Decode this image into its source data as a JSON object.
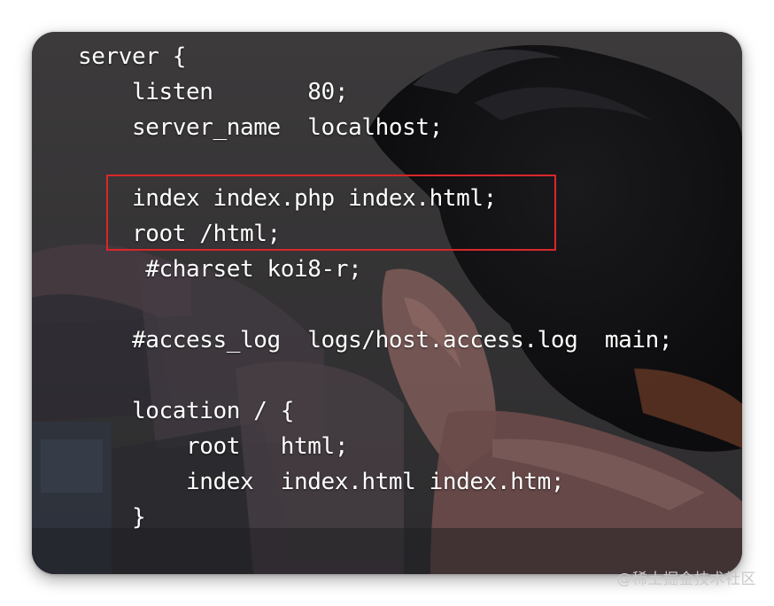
{
  "code_lines": [
    "server {",
    "    listen       80;",
    "    server_name  localhost;",
    "",
    "    index index.php index.html;",
    "    root /html;",
    "     #charset koi8-r;",
    "",
    "    #access_log  logs/host.access.log  main;",
    "",
    "    location / {",
    "        root   html;",
    "        index  index.html index.htm;",
    "    }"
  ],
  "highlight_color": "#d9272b",
  "watermark": "@稀土掘金技术社区"
}
